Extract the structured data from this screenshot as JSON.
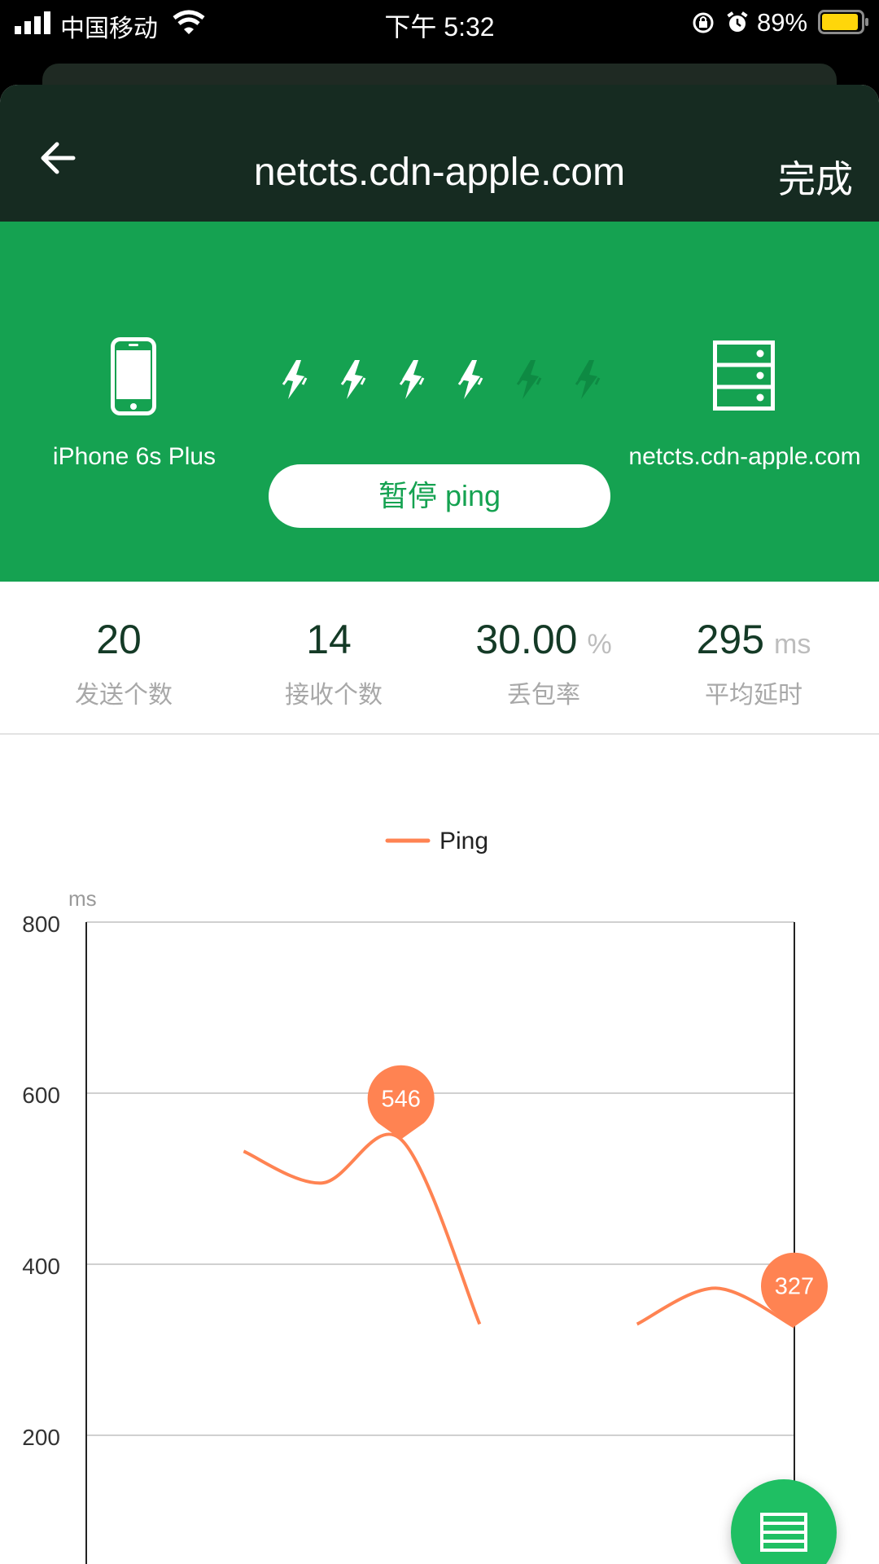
{
  "status_bar": {
    "carrier": "中国移动",
    "time": "下午 5:32",
    "battery": "89%"
  },
  "navbar": {
    "title": "netcts.cdn-apple.com",
    "done_label": "完成"
  },
  "panel": {
    "device_label": "iPhone 6s Plus",
    "server_label": "netcts.cdn-apple.com",
    "pause_label": "暂停 ping",
    "pulses_total": 6,
    "pulses_active": 4
  },
  "stats": [
    {
      "value": "20",
      "unit": "",
      "label": "发送个数"
    },
    {
      "value": "14",
      "unit": "",
      "label": "接收个数"
    },
    {
      "value": "30.00",
      "unit": "%",
      "label": "丢包率"
    },
    {
      "value": "295",
      "unit": "ms",
      "label": "平均延时"
    }
  ],
  "chart_data": {
    "type": "line",
    "legend": [
      "Ping"
    ],
    "ylabel": "ms",
    "ylim": [
      0,
      800
    ],
    "yticks": [
      0,
      200,
      400,
      600,
      800
    ],
    "series": [
      {
        "name": "Ping",
        "color": "#ff8352",
        "points": [
          {
            "x": 2,
            "y": 532
          },
          {
            "x": 3,
            "y": 495
          },
          {
            "x": 4,
            "y": 546
          },
          {
            "x": 5,
            "y": 330
          },
          {
            "x": 7,
            "y": 330
          },
          {
            "x": 8,
            "y": 372
          },
          {
            "x": 9,
            "y": 327
          }
        ],
        "segments": [
          [
            0,
            3
          ],
          [
            4,
            6
          ]
        ]
      }
    ],
    "xlim": [
      0,
      9
    ],
    "markers": [
      {
        "x": 4,
        "y": 546,
        "label": "546"
      },
      {
        "x": 9,
        "y": 327,
        "label": "327"
      }
    ]
  },
  "colors": {
    "green": "#15a251",
    "nav_dark": "#162b21",
    "accent_orange": "#ff8352",
    "fab_green": "#1fbf63"
  }
}
